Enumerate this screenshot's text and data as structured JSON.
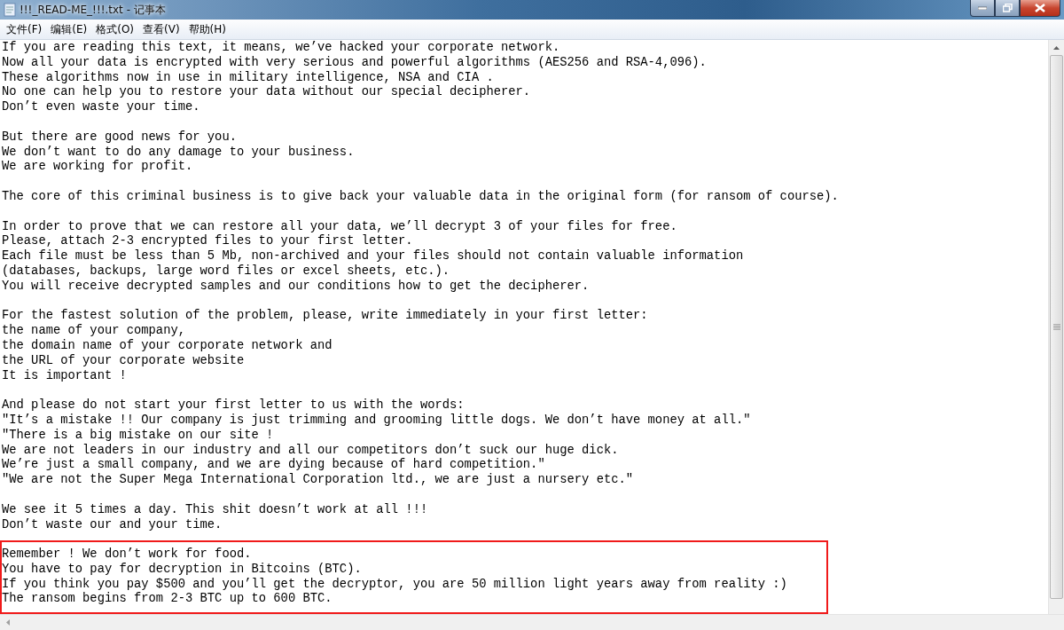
{
  "window": {
    "title": "!!!_READ-ME_!!!.txt - 记事本"
  },
  "menu": [
    "文件(F)",
    "编辑(E)",
    "格式(O)",
    "查看(V)",
    "帮助(H)"
  ],
  "paragraphs": [
    {
      "highlighted": false,
      "lines": [
        "If you are reading this text, it means, we’ve hacked your corporate network.",
        "Now all your data is encrypted with very serious and powerful algorithms (AES256 and RSA-4,096).",
        "These algorithms now in use in military intelligence, NSA and CIA .",
        "No one can help you to restore your data without our special decipherer.",
        "Don’t even waste your time."
      ]
    },
    {
      "highlighted": false,
      "lines": [
        "But there are good news for you.",
        "We don’t want to do any damage to your business.",
        "We are working for profit."
      ]
    },
    {
      "highlighted": false,
      "lines": [
        "The core of this criminal business is to give back your valuable data in the original form (for ransom of course)."
      ]
    },
    {
      "highlighted": false,
      "lines": [
        "In order to prove that we can restore all your data, we’ll decrypt 3 of your files for free.",
        "Please, attach 2-3 encrypted files to your first letter.",
        "Each file must be less than 5 Mb, non-archived and your files should not contain valuable information",
        "(databases, backups, large word files or excel sheets, etc.).",
        "You will receive decrypted samples and our conditions how to get the decipherer."
      ]
    },
    {
      "highlighted": false,
      "lines": [
        "For the fastest solution of the problem, please, write immediately in your first letter:",
        "the name of your company,",
        "the domain name of your corporate network and",
        "the URL of your corporate website",
        "It is important !"
      ]
    },
    {
      "highlighted": false,
      "lines": [
        "And please do not start your first letter to us with the words:",
        "″It’s a mistake !! Our company is just trimming and grooming little dogs. We don’t have money at all.″",
        "″There is a big mistake on our site !",
        "We are not leaders in our industry and all our competitors don’t suck our huge dick.",
        "We’re just a small company, and we are dying because of hard competition.″",
        "″We are not the Super Mega International Corporation ltd., we are just a nursery etc.″"
      ]
    },
    {
      "highlighted": false,
      "lines": [
        "We see it 5 times a day. This shit doesn’t work at all !!!",
        "Don’t waste our and your time."
      ]
    },
    {
      "highlighted": true,
      "lines": [
        "Remember ! We don’t work for food.",
        "You have to pay for decryption in Bitcoins (BTC).",
        "If you think you pay $500 and you’ll get the decryptor, you are 50 million light years away from reality :)",
        "The ransom begins from 2-3 BTC up to 600 BTC."
      ]
    }
  ]
}
